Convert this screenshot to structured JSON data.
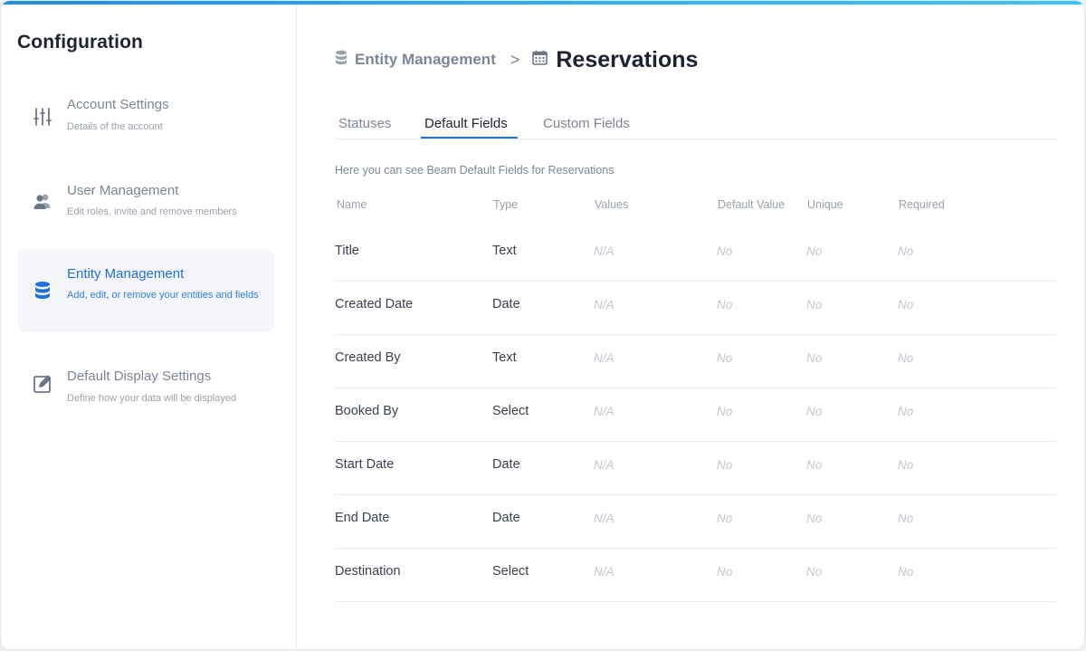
{
  "sidebar": {
    "title": "Configuration",
    "items": [
      {
        "label": "Account Settings",
        "desc": "Details of the account",
        "icon": "sliders-icon"
      },
      {
        "label": "User Management",
        "desc": "Edit roles, invite and remove members",
        "icon": "users-icon"
      },
      {
        "label": "Entity Management",
        "desc": "Add, edit, or remove your entities and fields",
        "icon": "database-icon"
      },
      {
        "label": "Default Display Settings",
        "desc": "Define how your data will be displayed",
        "icon": "edit-icon"
      }
    ],
    "active_index": 2
  },
  "header": {
    "parent": "Entity Management",
    "separator": ">",
    "current": "Reservations"
  },
  "tabs": [
    {
      "label": "Statuses"
    },
    {
      "label": "Default Fields"
    },
    {
      "label": "Custom Fields"
    }
  ],
  "active_tab": "Default Fields",
  "intro": "Here you can see Beam Default Fields for Reservations",
  "table": {
    "columns": [
      "Name",
      "Type",
      "Values",
      "Default Value",
      "Unique",
      "Required"
    ],
    "rows": [
      [
        "Title",
        "Text",
        "N/A",
        "No",
        "No",
        "No"
      ],
      [
        "Created Date",
        "Date",
        "N/A",
        "No",
        "No",
        "No"
      ],
      [
        "Created By",
        "Text",
        "N/A",
        "No",
        "No",
        "No"
      ],
      [
        "Booked By",
        "Select",
        "N/A",
        "No",
        "No",
        "No"
      ],
      [
        "Start Date",
        "Date",
        "N/A",
        "No",
        "No",
        "No"
      ],
      [
        "End Date",
        "Date",
        "N/A",
        "No",
        "No",
        "No"
      ],
      [
        "Destination",
        "Select",
        "N/A",
        "No",
        "No",
        "No"
      ]
    ]
  },
  "colors": {
    "accent": "#1f6fdc",
    "top_bar": "#2fb6f0",
    "text_dark": "#1e2230",
    "text_muted": "#7e8696"
  }
}
